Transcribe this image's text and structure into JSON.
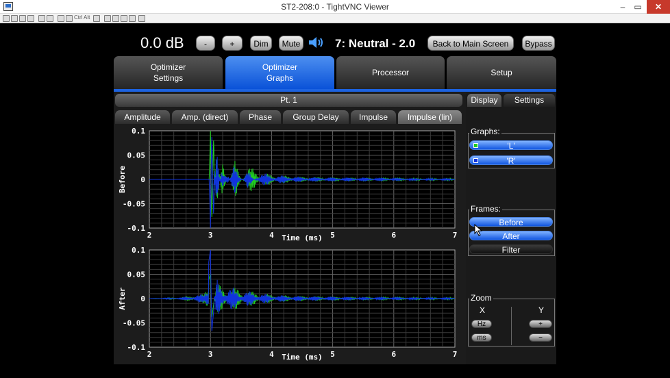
{
  "window": {
    "title": "ST2-208:0 - TightVNC Viewer",
    "min": "–",
    "max": "▭",
    "close": "✕"
  },
  "toolbar": {
    "text_items": [
      "Ctrl",
      "Alt"
    ]
  },
  "top_bar": {
    "volume": "0.0 dB",
    "minus_label": "-",
    "plus_label": "+",
    "dim_label": "Dim",
    "mute_label": "Mute",
    "speaker_icon": "speaker-icon",
    "preset": "7: Neutral - 2.0",
    "back_label": "Back to Main Screen",
    "bypass_label": "Bypass"
  },
  "tabs": [
    {
      "line1": "Optimizer",
      "line2": "Settings"
    },
    {
      "line1": "Optimizer",
      "line2": "Graphs"
    },
    {
      "line1": "Processor",
      "line2": ""
    },
    {
      "line1": "Setup",
      "line2": ""
    }
  ],
  "point_header": "Pt. 1",
  "subtabs": [
    "Amplitude",
    "Amp. (direct)",
    "Phase",
    "Group Delay",
    "Impulse",
    "Impulse (lin)"
  ],
  "right_panel": {
    "tab_display": "Display",
    "tab_settings": "Settings",
    "graphs_label": "Graphs:",
    "graph_items": [
      {
        "label": "'L'",
        "color": "#22cc22"
      },
      {
        "label": "'R'",
        "color": "#1133dd"
      }
    ],
    "frames_label": "Frames:",
    "frame_items": [
      "Before",
      "After",
      "Filter"
    ],
    "zoom_label": "Zoom",
    "zoom_x": "X",
    "zoom_y": "Y",
    "hz_label": "Hz",
    "ms_label": "ms",
    "y_plus": "+",
    "y_minus": "−"
  },
  "colors": {
    "accent_blue": "#1d63e0",
    "series_left": "#22cc22",
    "series_right": "#1133dd"
  },
  "chart_data": [
    {
      "type": "line",
      "title": "Before",
      "ylabel": "Before",
      "xlabel": "Time (ms)",
      "xlim": [
        2,
        7
      ],
      "ylim": [
        -0.1,
        0.1
      ],
      "x_ticks": [
        "2",
        "3",
        "4",
        "5",
        "6",
        "7"
      ],
      "y_ticks": [
        "0.1",
        "0.05",
        "0",
        "-0.05",
        "-0.1"
      ],
      "grid": true,
      "series": [
        {
          "name": "'L'",
          "color": "#22cc22",
          "x": [
            2.0,
            2.98,
            3.0,
            3.02,
            3.05,
            3.1,
            3.2,
            3.4,
            3.6,
            3.8,
            4.0,
            4.5,
            5.0,
            5.5,
            6.0,
            6.5,
            7.0
          ],
          "y": [
            0,
            0,
            0.1,
            -0.09,
            0.08,
            -0.06,
            0.05,
            -0.04,
            0.03,
            0.015,
            0.01,
            0.005,
            0.004,
            0.003,
            0.003,
            0.002,
            0.002
          ]
        },
        {
          "name": "'R'",
          "color": "#1133dd",
          "x": [
            2.0,
            2.98,
            3.0,
            3.02,
            3.05,
            3.1,
            3.2,
            3.4,
            3.6,
            3.8,
            4.0,
            4.5,
            5.0,
            5.5,
            6.0,
            6.5,
            7.0
          ],
          "y": [
            0,
            0,
            -0.1,
            0.1,
            -0.07,
            0.06,
            -0.05,
            0.035,
            -0.02,
            0.015,
            0.01,
            0.005,
            0.004,
            0.004,
            0.003,
            0.002,
            0.002
          ]
        }
      ]
    },
    {
      "type": "line",
      "title": "After",
      "ylabel": "After",
      "xlabel": "Time (ms)",
      "xlim": [
        2,
        7
      ],
      "ylim": [
        -0.1,
        0.1
      ],
      "x_ticks": [
        "2",
        "3",
        "4",
        "5",
        "6",
        "7"
      ],
      "y_ticks": [
        "0.1",
        "0.05",
        "0",
        "-0.05",
        "-0.1"
      ],
      "grid": true,
      "series": [
        {
          "name": "'L'",
          "color": "#22cc22",
          "x": [
            2.0,
            2.5,
            2.9,
            3.0,
            3.02,
            3.1,
            3.3,
            3.5,
            3.8,
            4.0,
            4.5,
            5.0,
            5.5,
            6.0,
            6.5,
            7.0
          ],
          "y": [
            0,
            0.002,
            0.01,
            0.05,
            -0.04,
            0.03,
            0.025,
            0.02,
            0.012,
            0.008,
            0.005,
            0.004,
            0.003,
            0.003,
            0.002,
            0.002
          ]
        },
        {
          "name": "'R'",
          "color": "#1133dd",
          "x": [
            2.0,
            2.5,
            2.9,
            3.0,
            3.02,
            3.1,
            3.3,
            3.5,
            3.8,
            4.0,
            4.5,
            5.0,
            5.5,
            6.0,
            6.5,
            7.0
          ],
          "y": [
            0,
            0.002,
            0.01,
            0.1,
            -0.07,
            0.04,
            0.025,
            0.018,
            0.012,
            0.008,
            0.005,
            0.004,
            0.003,
            0.003,
            0.002,
            0.002
          ]
        }
      ]
    }
  ]
}
